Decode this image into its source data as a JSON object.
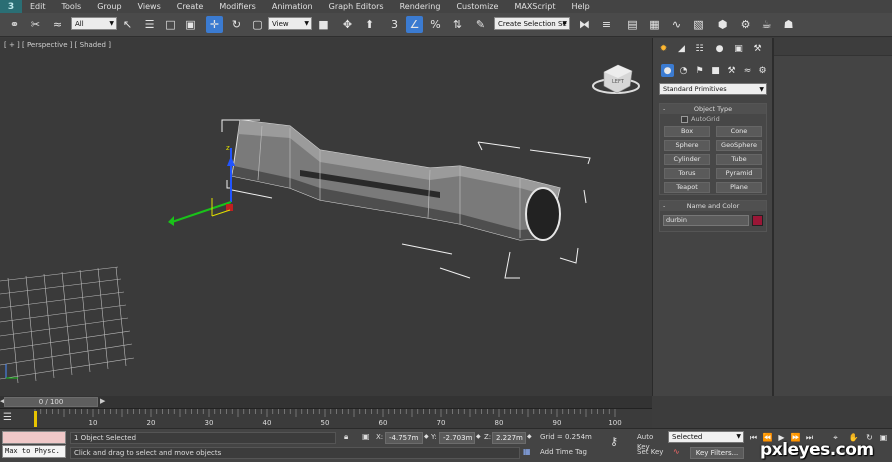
{
  "app": {
    "logo": "3"
  },
  "menu": [
    "Edit",
    "Tools",
    "Group",
    "Views",
    "Create",
    "Modifiers",
    "Animation",
    "Graph Editors",
    "Rendering",
    "Customize",
    "MAXScript",
    "Help"
  ],
  "toolbar": {
    "filter_value": "All",
    "refcoord_value": "View",
    "named_selection_value": "Create Selection Se",
    "snap_label": "3",
    "percent_label": "%"
  },
  "viewport": {
    "label": "[ + ] [ Perspective ] [ Shaded ]",
    "viewcube_label": "LEFT"
  },
  "command_panel": {
    "dropdown_value": "Standard Primitives",
    "object_type": {
      "title": "Object Type",
      "autogrid_label": "AutoGrid",
      "buttons": [
        "Box",
        "Cone",
        "Sphere",
        "GeoSphere",
        "Cylinder",
        "Tube",
        "Torus",
        "Pyramid",
        "Teapot",
        "Plane"
      ]
    },
    "name_color": {
      "title": "Name and Color",
      "name_value": "durbin",
      "swatch_color": "#9a1636"
    }
  },
  "timeline": {
    "slider_label": "0 / 100",
    "ticks": [
      "10",
      "20",
      "30",
      "40",
      "50",
      "60",
      "70",
      "80",
      "90",
      "100"
    ]
  },
  "status": {
    "maxscript_output": "Max to Physc.",
    "selection_text": "1 Object Selected",
    "prompt_text": "Click and drag to select and move objects",
    "x_label": "X:",
    "x_value": "-4.757m",
    "y_label": "Y:",
    "y_value": "-2.703m",
    "z_label": "Z:",
    "z_value": "2.227m",
    "grid_text": "Grid = 0.254m",
    "add_time_tag": "Add Time Tag",
    "auto_key": "Auto Key",
    "set_key": "Set Key",
    "selected_value": "Selected",
    "key_filters": "Key Filters..."
  },
  "watermark": "pxleyes.com",
  "colors": {
    "accent": "#3b7bd1",
    "viewport_bg": "#3a3a3a"
  }
}
